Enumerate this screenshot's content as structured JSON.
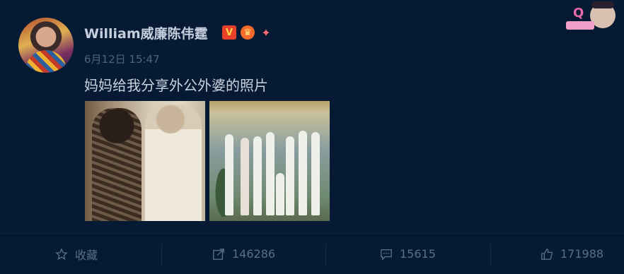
{
  "post": {
    "username": "William威廉陈伟霆",
    "timestamp": "6月12日 15:47",
    "text": "妈妈给我分享外公外婆的照片",
    "badges": [
      "vip-v-icon",
      "crown-icon",
      "gift-icon"
    ],
    "badge_v_label": "V"
  },
  "actions": {
    "favorite_label": "收藏",
    "repost_count": "146286",
    "comment_count": "15615",
    "like_count": "171988"
  },
  "colors": {
    "background": "#071a33",
    "username": "#c6cfdd",
    "muted": "#5a6d8a",
    "vip_badge": "#e8402a"
  }
}
